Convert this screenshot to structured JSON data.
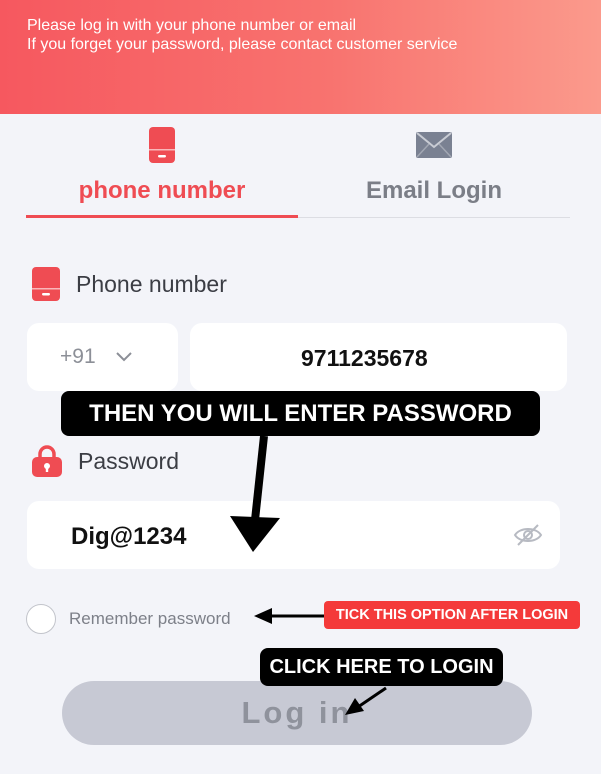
{
  "header": {
    "line1": "Please log in with your phone number or email",
    "line2": "If you forget your password, please contact customer service"
  },
  "tabs": [
    {
      "label": "phone number",
      "icon": "phone-icon",
      "active": true
    },
    {
      "label": "Email Login",
      "icon": "mail-icon",
      "active": false
    }
  ],
  "phone": {
    "label": "Phone number",
    "country_code": "+91",
    "value": "9711235678"
  },
  "password": {
    "label": "Password",
    "value": "Dig@1234"
  },
  "remember": {
    "label": "Remember password",
    "checked": false
  },
  "login_button": {
    "label": "Log in"
  },
  "annotations": {
    "password_callout": "THEN YOU WILL ENTER PASSWORD",
    "tick_callout": "TICK THIS OPTION AFTER LOGIN",
    "login_callout": "CLICK HERE TO LOGIN"
  },
  "colors": {
    "accent": "#ef4c53",
    "header_gradient_start": "#f6585f",
    "header_gradient_end": "#fb9a8c",
    "button_disabled": "#c7c9d4",
    "callout_red": "#f43a3a"
  }
}
